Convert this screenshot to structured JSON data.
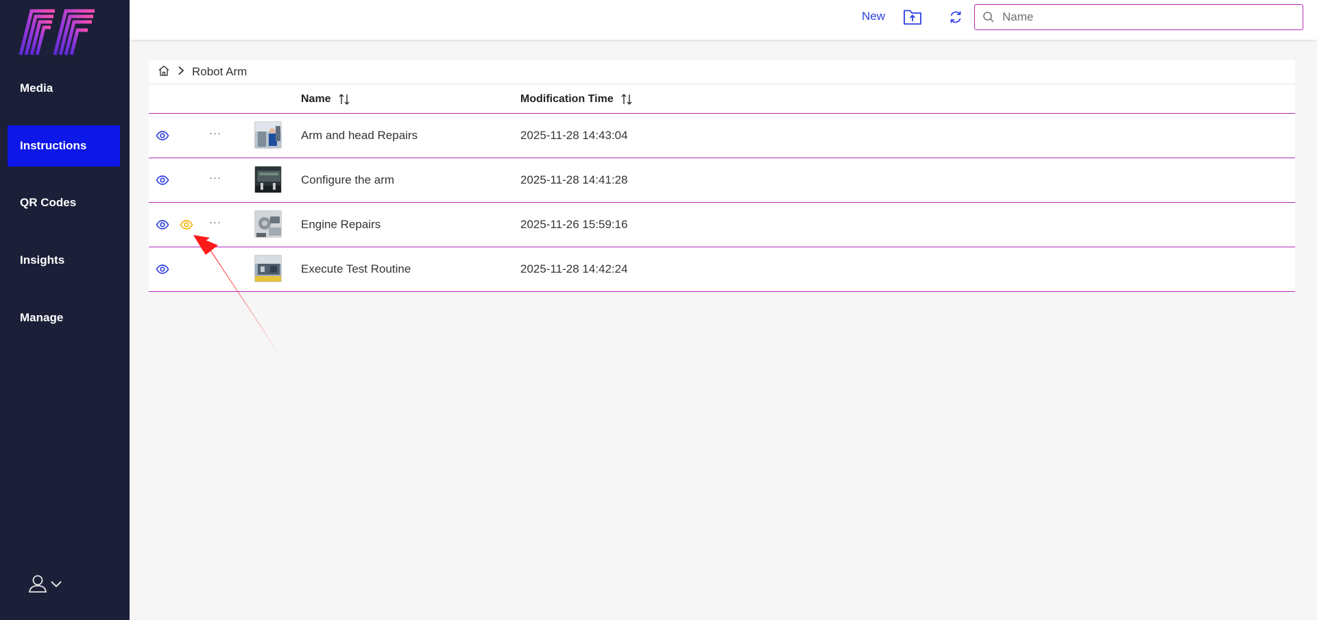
{
  "sidebar": {
    "items": [
      {
        "label": "Media",
        "active": false
      },
      {
        "label": "Instructions",
        "active": true
      },
      {
        "label": "QR Codes",
        "active": false
      },
      {
        "label": "Insights",
        "active": false
      },
      {
        "label": "Manage",
        "active": false
      }
    ],
    "user_icon": "user-icon",
    "accent": "#0c17e8",
    "background": "#1b1f38"
  },
  "toolbar": {
    "new_label": "New",
    "upload_icon": "folder-upload-icon",
    "refresh_icon": "refresh-icon",
    "search": {
      "placeholder": "Name",
      "value": ""
    }
  },
  "breadcrumb": {
    "home_icon": "home-icon",
    "separator_icon": "chevron-right-icon",
    "current": "Robot Arm"
  },
  "table": {
    "columns": [
      {
        "label": "Name",
        "sortable": true
      },
      {
        "label": "Modification Time",
        "sortable": true
      }
    ],
    "rows": [
      {
        "name": "Arm and head Repairs",
        "time": "2025-11-28 14:43:04",
        "has_preview": false,
        "has_more": true
      },
      {
        "name": "Configure the arm",
        "time": "2025-11-28 14:41:28",
        "has_preview": false,
        "has_more": true
      },
      {
        "name": "Engine Repairs",
        "time": "2025-11-26 15:59:16",
        "has_preview": true,
        "has_more": true
      },
      {
        "name": "Execute Test Routine",
        "time": "2025-11-28 14:42:24",
        "has_preview": false,
        "has_more": false
      }
    ],
    "more_label": "···",
    "row_divider_color": "#b326b8",
    "view_icon_color": "#2d3ee0",
    "preview_icon_color": "#f0b400"
  },
  "annotation": {
    "color": "#ff1a1a"
  }
}
